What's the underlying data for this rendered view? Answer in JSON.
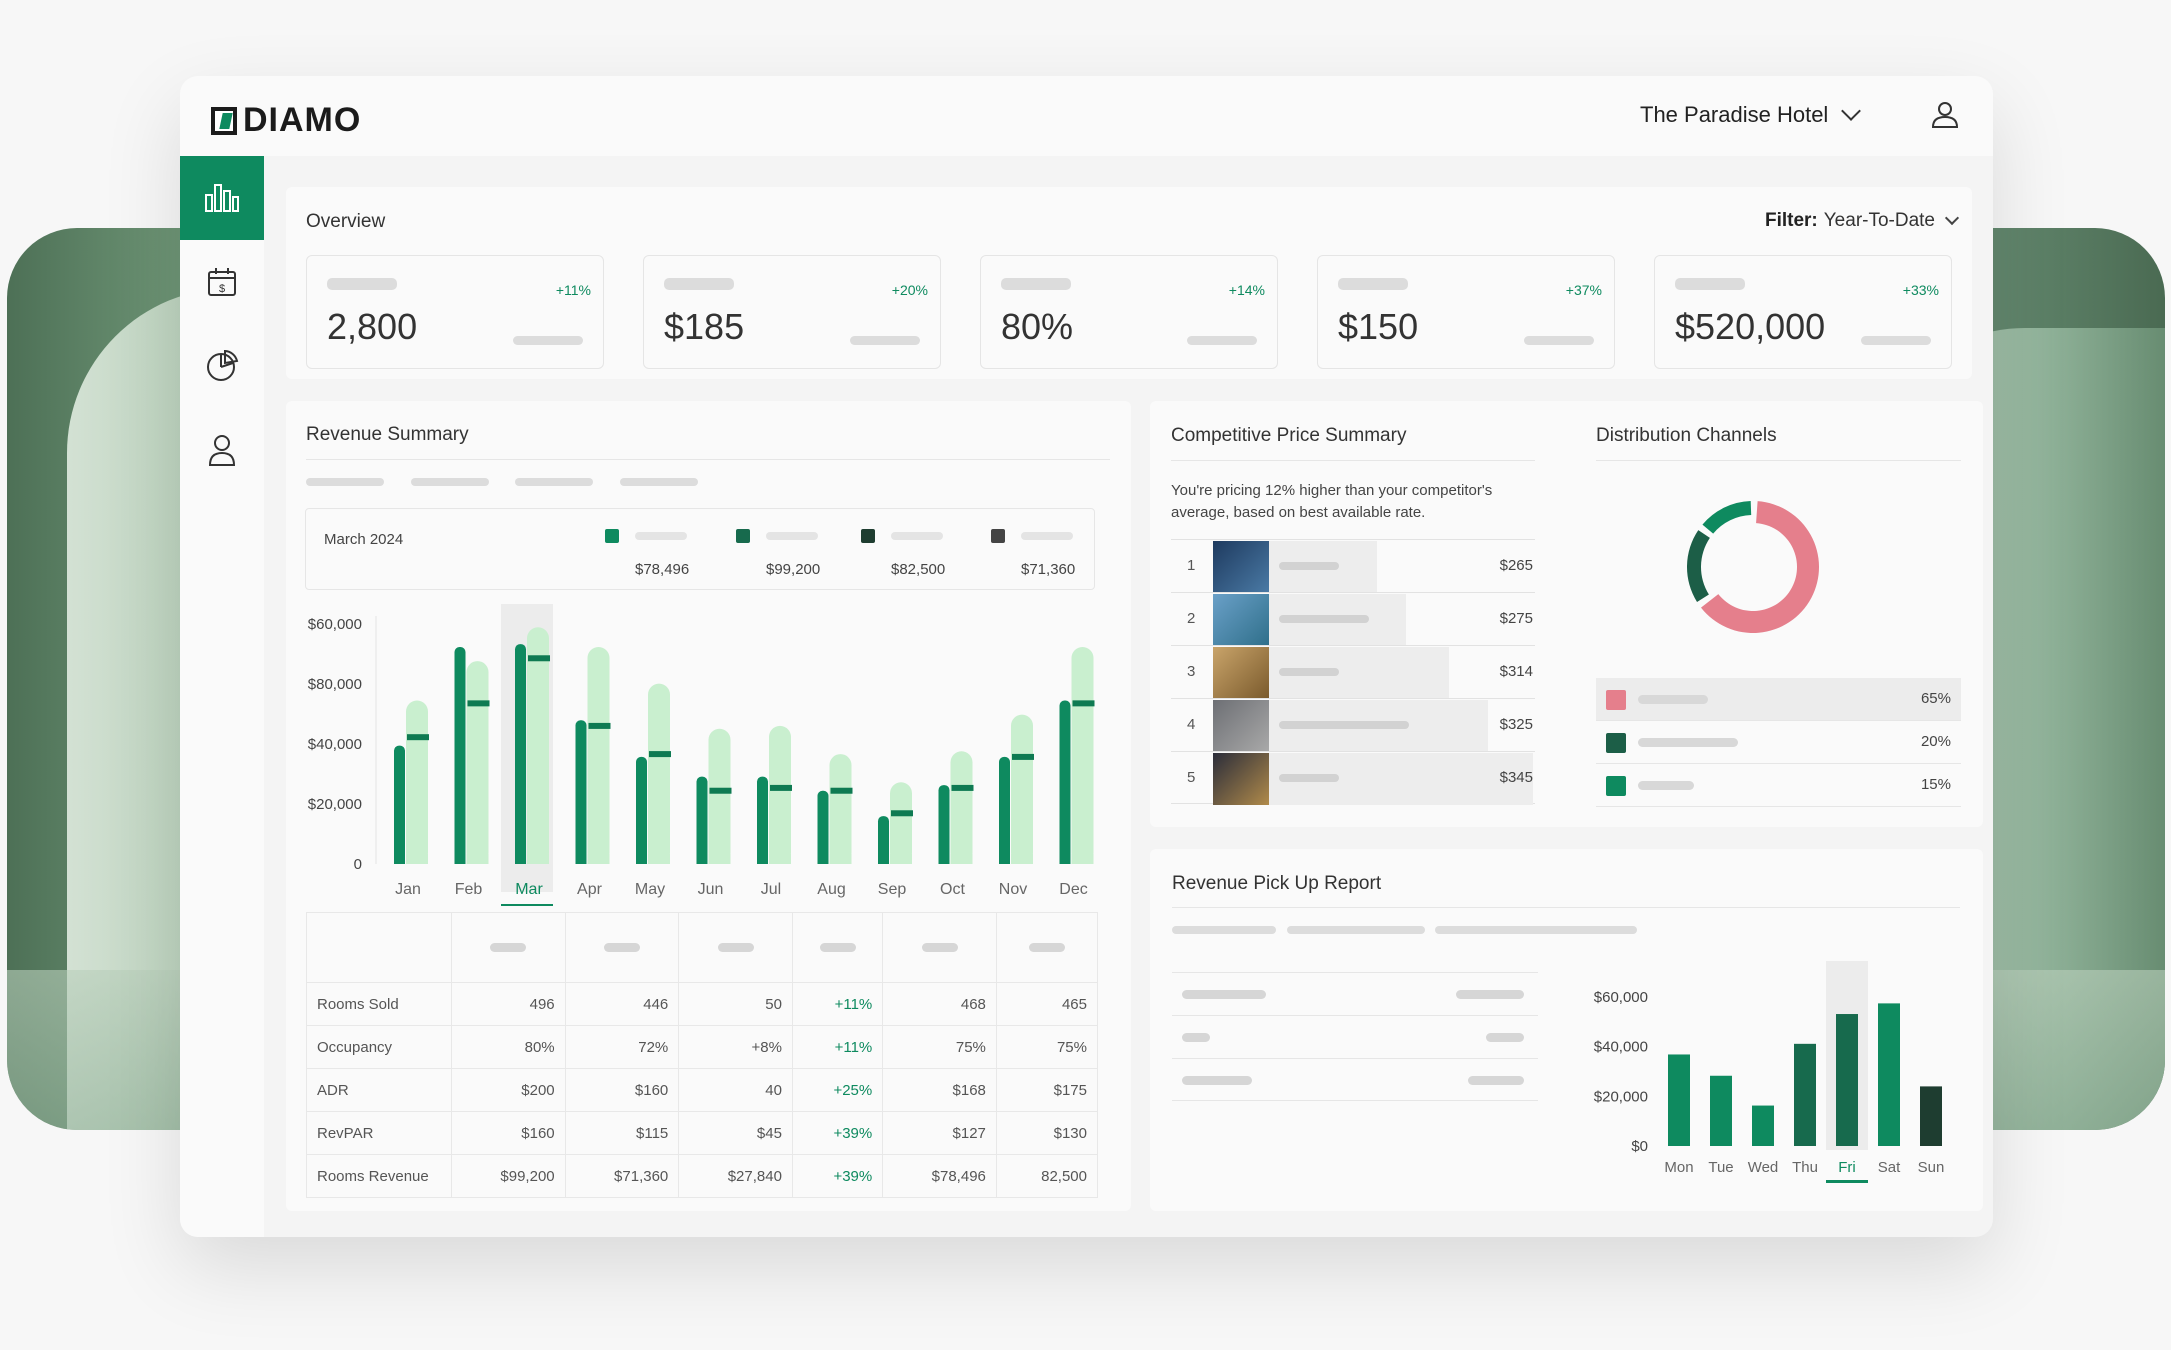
{
  "header": {
    "brand": "DIAMO",
    "hotel": "The Paradise Hotel"
  },
  "sidebar": {
    "items": [
      "analytics-icon",
      "calendar-icon",
      "pie-chart-icon",
      "user-icon"
    ]
  },
  "overview": {
    "title": "Overview",
    "filter_label": "Filter:",
    "filter_value": "Year-To-Date",
    "kpis": [
      {
        "value": "2,800",
        "delta": "+11%"
      },
      {
        "value": "$185",
        "delta": "+20%"
      },
      {
        "value": "80%",
        "delta": "+14%"
      },
      {
        "value": "$150",
        "delta": "+37%"
      },
      {
        "value": "$520,000",
        "delta": "+33%"
      }
    ]
  },
  "revenue_summary": {
    "title": "Revenue Summary",
    "legend_month": "March 2024",
    "legend": [
      {
        "value": "$78,496",
        "color": "#0e8a5f"
      },
      {
        "value": "$99,200",
        "color": "#176a4d"
      },
      {
        "value": "$82,500",
        "color": "#1e3d30"
      },
      {
        "value": "$71,360",
        "color": "#444444"
      }
    ],
    "table": {
      "rows": [
        {
          "label": "Rooms Sold",
          "cells": [
            "496",
            "446",
            "50",
            "+11%",
            "468",
            "465"
          ]
        },
        {
          "label": "Occupancy",
          "cells": [
            "80%",
            "72%",
            "+8%",
            "+11%",
            "75%",
            "75%"
          ]
        },
        {
          "label": "ADR",
          "cells": [
            "$200",
            "$160",
            "40",
            "+25%",
            "$168",
            "$175"
          ]
        },
        {
          "label": "RevPAR",
          "cells": [
            "$160",
            "$115",
            "$45",
            "+39%",
            "$127",
            "$130"
          ]
        },
        {
          "label": "Rooms Revenue",
          "cells": [
            "$99,200",
            "$71,360",
            "$27,840",
            "+39%",
            "$78,496",
            "82,500"
          ]
        }
      ]
    }
  },
  "chart_data": [
    {
      "type": "bar",
      "title": "Revenue Summary",
      "categories": [
        "Jan",
        "Feb",
        "Mar",
        "Apr",
        "May",
        "Jun",
        "Jul",
        "Aug",
        "Sep",
        "Oct",
        "Nov",
        "Dec"
      ],
      "y_tick_labels": [
        "$60,000",
        "$80,000",
        "$40,000",
        "$20,000",
        "0"
      ],
      "selected_category": "Mar",
      "series": [
        {
          "values": [
            42,
            77,
            78,
            51,
            38,
            31,
            31,
            26,
            17,
            28,
            38,
            58
          ],
          "color": "#0e8a5f"
        },
        {
          "values": [
            58,
            72,
            84,
            77,
            64,
            48,
            49,
            39,
            29,
            40,
            53,
            77
          ],
          "color": "#c9efcf"
        }
      ],
      "markers": [
        45,
        57,
        73,
        49,
        39,
        26,
        27,
        26,
        18,
        27,
        38,
        57
      ],
      "ylim": [
        0,
        88
      ]
    },
    {
      "type": "pie",
      "title": "Distribution Channels",
      "labels": [
        "",
        "",
        ""
      ],
      "values": [
        65,
        20,
        15
      ],
      "colors": [
        "#e57f8c",
        "#1c5e47",
        "#0e8a5f"
      ]
    },
    {
      "type": "bar",
      "title": "Revenue Pick Up Report",
      "categories": [
        "Mon",
        "Tue",
        "Wed",
        "Thu",
        "Fri",
        "Sat",
        "Sun"
      ],
      "y_tick_labels": [
        "$60,000",
        "$40,000",
        "$20,000",
        "$0"
      ],
      "selected_category": "Fri",
      "values": [
        43000,
        33000,
        19000,
        48000,
        62000,
        67000,
        28000
      ],
      "colors": [
        "#0e8a5f",
        "#0e8a5f",
        "#0e8a5f",
        "#176a4d",
        "#176a4d",
        "#0e8a5f",
        "#1e3d30"
      ],
      "ylim": [
        0,
        70000
      ]
    }
  ],
  "competitive": {
    "title": "Competitive Price Summary",
    "description": "You're pricing 12% higher than your competitor's average, based on best available rate.",
    "rows": [
      {
        "rank": "1",
        "price": "$265",
        "share": 0.41
      },
      {
        "rank": "2",
        "price": "$275",
        "share": 0.52
      },
      {
        "rank": "3",
        "price": "$314",
        "share": 0.68
      },
      {
        "rank": "4",
        "price": "$325",
        "share": 0.83
      },
      {
        "rank": "5",
        "price": "$345",
        "share": 1.0
      }
    ]
  },
  "distribution": {
    "title": "Distribution Channels",
    "rows": [
      {
        "pct": "65%",
        "color": "#e57f8c"
      },
      {
        "pct": "20%",
        "color": "#1c5e47"
      },
      {
        "pct": "15%",
        "color": "#0e8a5f"
      }
    ]
  },
  "pickup": {
    "title": "Revenue Pick Up Report"
  }
}
